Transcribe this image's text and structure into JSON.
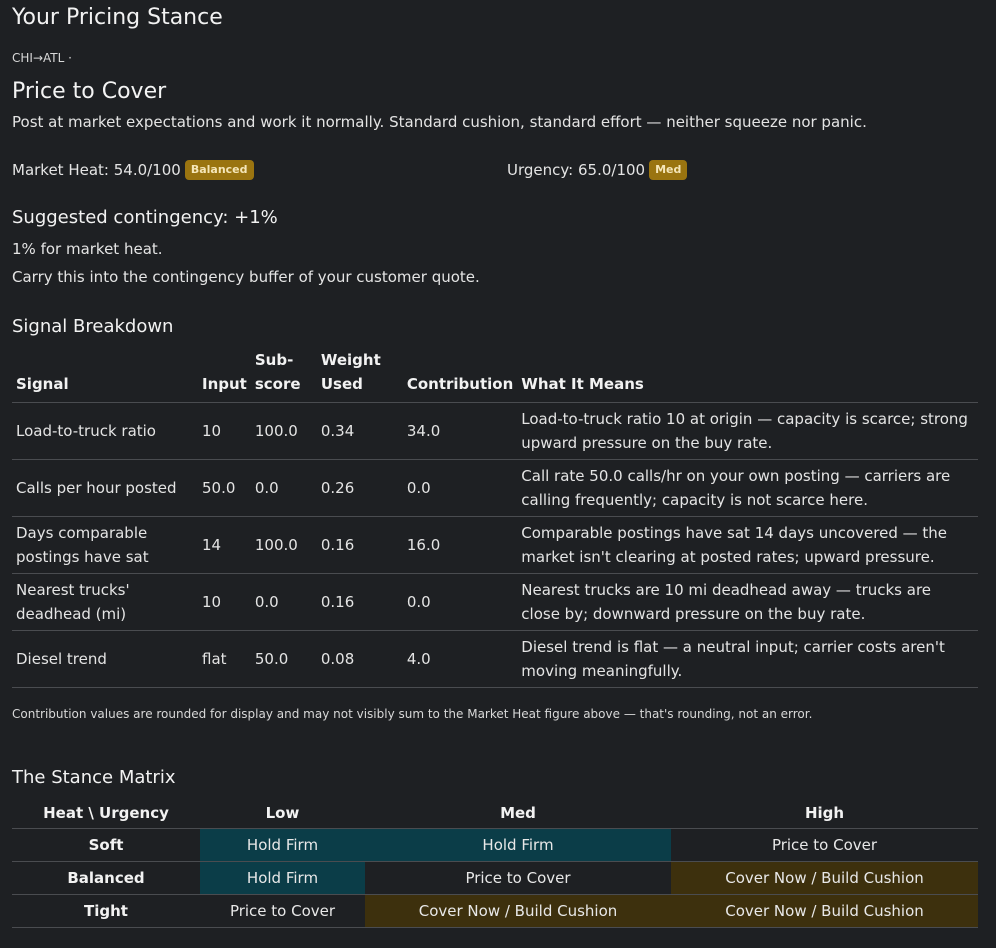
{
  "page": {
    "title": "Your Pricing Stance",
    "route": "CHI→ATL ·"
  },
  "stance": {
    "name": "Price to Cover",
    "description": "Post at market expectations and work it normally. Standard cushion, standard effort — neither squeeze nor panic."
  },
  "metrics": {
    "heat_label": "Market Heat: 54.0/100",
    "heat_badge": "Balanced",
    "urgency_label": "Urgency: 65.0/100",
    "urgency_badge": "Med",
    "badge_color": "#9a7410"
  },
  "contingency": {
    "heading": "Suggested contingency: +1%",
    "reason": "1% for market heat.",
    "instruction": "Carry this into the contingency buffer of your customer quote."
  },
  "signals": {
    "heading": "Signal Breakdown",
    "columns": [
      "Signal",
      "Input",
      "Sub-score",
      "Weight Used",
      "Contribution",
      "What It Means"
    ],
    "rows": [
      [
        "Load-to-truck ratio",
        "10",
        "100.0",
        "0.34",
        "34.0",
        "Load-to-truck ratio 10 at origin — capacity is scarce; strong upward pressure on the buy rate."
      ],
      [
        "Calls per hour posted",
        "50.0",
        "0.0",
        "0.26",
        "0.0",
        "Call rate 50.0 calls/hr on your own posting — carriers are calling frequently; capacity is not scarce here."
      ],
      [
        "Days comparable postings have sat",
        "14",
        "100.0",
        "0.16",
        "16.0",
        "Comparable postings have sat 14 days uncovered — the market isn't clearing at posted rates; upward pressure."
      ],
      [
        "Nearest trucks' deadhead (mi)",
        "10",
        "0.0",
        "0.16",
        "0.0",
        "Nearest trucks are 10 mi deadhead away — trucks are close by; downward pressure on the buy rate."
      ],
      [
        "Diesel trend",
        "flat",
        "50.0",
        "0.08",
        "4.0",
        "Diesel trend is flat — a neutral input; carrier costs aren't moving meaningfully."
      ]
    ],
    "note": "Contribution values are rounded for display and may not visibly sum to the Market Heat figure above — that's rounding, not an error."
  },
  "matrix": {
    "heading": "The Stance Matrix",
    "corner": "Heat \\ Urgency",
    "columns": [
      "Low",
      "Med",
      "High"
    ],
    "rows": [
      {
        "label": "Soft",
        "cells": [
          "Hold Firm",
          "Hold Firm",
          "Price to Cover"
        ]
      },
      {
        "label": "Balanced",
        "cells": [
          "Hold Firm",
          "Price to Cover",
          "Cover Now / Build Cushion"
        ]
      },
      {
        "label": "Tight",
        "cells": [
          "Price to Cover",
          "Cover Now / Build Cushion",
          "Cover Now / Build Cushion"
        ]
      }
    ],
    "colors": {
      "Hold Firm": "#0b3d48",
      "Price to Cover": "transparent",
      "Cover Now / Build Cushion": "#3d300d"
    }
  }
}
